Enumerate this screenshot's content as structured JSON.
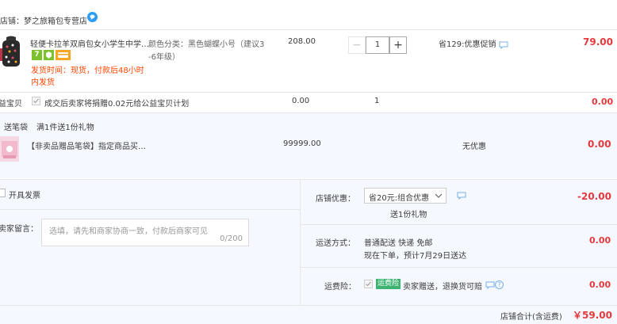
{
  "shop": {
    "prefix": "店铺：",
    "name": "梦之旅箱包专营店"
  },
  "item1": {
    "title": "轻便卡拉羊双肩包女小学生中学…",
    "sku": "颜色分类：黑色蝴蝶小号（建议3-6年级）",
    "sku_line1": "颜色分类：黑色蝴蝶小号（建议3",
    "sku_line2": "-6年级）",
    "unit_price": "208.00",
    "quantity": "1",
    "promo": "省129:优惠促销",
    "subtotal": "79.00",
    "badge1": "7",
    "delivery_line1": "发货时间：现货，付款后48小时",
    "delivery_line2": "内发货"
  },
  "charity": {
    "label": "公益宝贝",
    "text": "成交后卖家将捐赠0.02元给公益宝贝计划",
    "price": "0.00",
    "quantity": "1",
    "subtotal": "0.00"
  },
  "gift": {
    "tag": "送笔袋",
    "rule": "满1件送1份礼物",
    "title": "【非卖品赠品笔袋】指定商品买…",
    "price": "99999.00",
    "promo": "无优惠",
    "subtotal": "0.00"
  },
  "invoice": {
    "label": "开具发票"
  },
  "message": {
    "label": "给卖家留言：",
    "placeholder": "选填，请先和商家协商一致，付款后商家可见",
    "counter": "0/200"
  },
  "shop_discount": {
    "label": "店铺优惠：",
    "selected": "省20元:组合优惠",
    "note": "送1份礼物",
    "amount": "-20.00"
  },
  "shipping": {
    "label": "运送方式：",
    "method": "普通配送 快递 免邮",
    "eta": "现在下单，预计7月29日送达",
    "amount": "0.00"
  },
  "insurance": {
    "label": "运费险：",
    "badge": "运费险",
    "text": "卖家赠送，退换货可赔",
    "amount": "0.00"
  },
  "total": {
    "label": "店铺合计(含运费)",
    "amount": "￥59.00"
  }
}
